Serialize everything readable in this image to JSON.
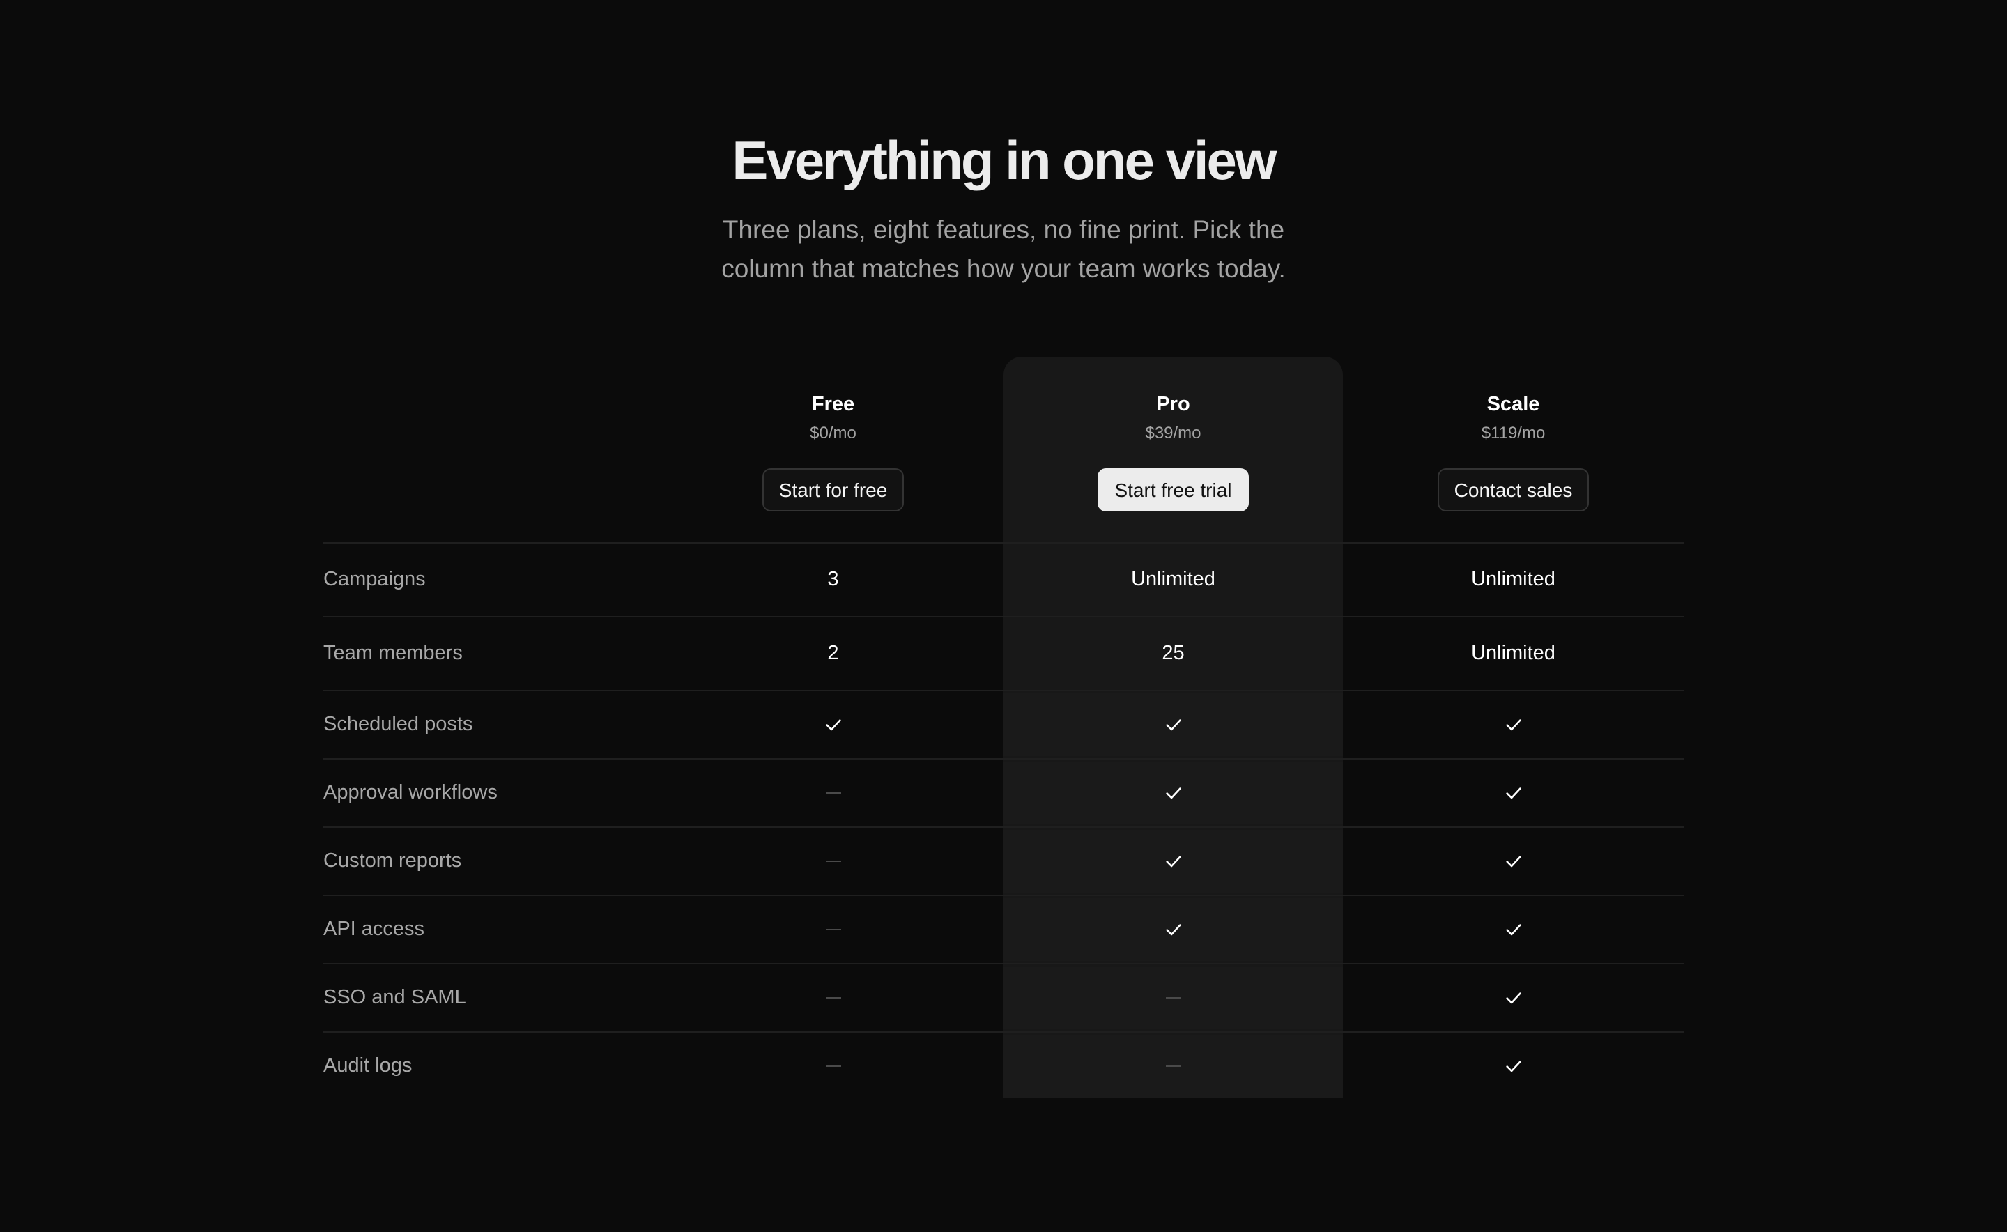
{
  "header": {
    "title": "Everything in one view",
    "subtitle": "Three plans, eight features, no fine print. Pick the column that matches how your team works today."
  },
  "colors": {
    "background": "#0b0b0b",
    "highlight_column": "#181818",
    "primary_button": "#ececec"
  },
  "plans": [
    {
      "name": "Free",
      "price": "$0/mo",
      "cta": "Start for free"
    },
    {
      "name": "Pro",
      "price": "$39/mo",
      "cta": "Start free trial"
    },
    {
      "name": "Scale",
      "price": "$119/mo",
      "cta": "Contact sales"
    }
  ],
  "features": [
    {
      "label": "Campaigns",
      "values": [
        "3",
        "Unlimited",
        "Unlimited"
      ]
    },
    {
      "label": "Team members",
      "values": [
        "2",
        "25",
        "Unlimited"
      ]
    },
    {
      "label": "Scheduled posts",
      "values": [
        "check-icon",
        "check-icon",
        "check-icon"
      ]
    },
    {
      "label": "Approval workflows",
      "values": [
        "dash-icon",
        "check-icon",
        "check-icon"
      ]
    },
    {
      "label": "Custom reports",
      "values": [
        "dash-icon",
        "check-icon",
        "check-icon"
      ]
    },
    {
      "label": "API access",
      "values": [
        "dash-icon",
        "check-icon",
        "check-icon"
      ]
    },
    {
      "label": "SSO and SAML",
      "values": [
        "dash-icon",
        "dash-icon",
        "check-icon"
      ]
    },
    {
      "label": "Audit logs",
      "values": [
        "dash-icon",
        "dash-icon",
        "check-icon"
      ]
    }
  ]
}
